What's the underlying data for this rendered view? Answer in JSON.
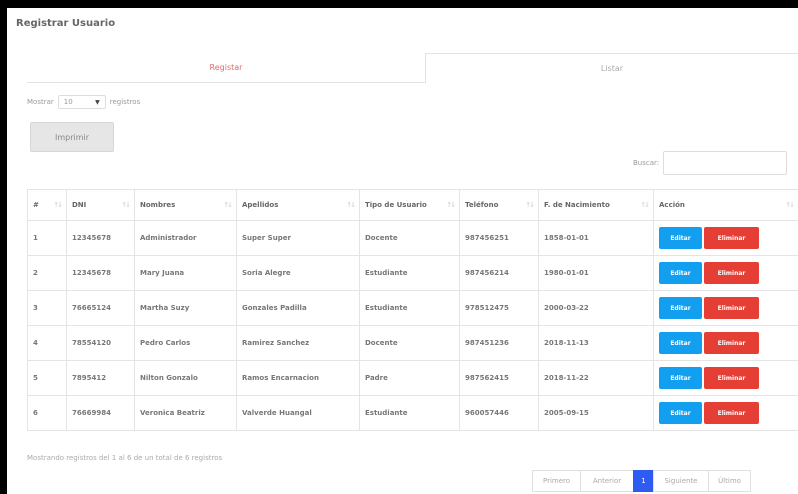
{
  "page_title": "Registrar Usuario",
  "tabs": {
    "register": "Registar",
    "list": "Listar"
  },
  "show": {
    "before": "Mostrar",
    "value": "10",
    "after": "registros"
  },
  "print_button": "Imprimir",
  "search": {
    "label": "Buscar:",
    "value": ""
  },
  "table": {
    "headers": [
      "#",
      "DNI",
      "Nombres",
      "Apellidos",
      "Tipo de Usuario",
      "Teléfono",
      "F. de Nacimiento",
      "Acción"
    ],
    "rows": [
      {
        "num": "1",
        "dni": "12345678",
        "nombres": "Administrador",
        "apellidos": "Super Super",
        "tipo": "Docente",
        "telefono": "987456251",
        "nacimiento": "1858-01-01"
      },
      {
        "num": "2",
        "dni": "12345678",
        "nombres": "Mary Juana",
        "apellidos": "Soria Alegre",
        "tipo": "Estudiante",
        "telefono": "987456214",
        "nacimiento": "1980-01-01"
      },
      {
        "num": "3",
        "dni": "76665124",
        "nombres": "Martha Suzy",
        "apellidos": "Gonzales Padilla",
        "tipo": "Estudiante",
        "telefono": "978512475",
        "nacimiento": "2000-03-22"
      },
      {
        "num": "4",
        "dni": "78554120",
        "nombres": "Pedro Carlos",
        "apellidos": "Ramirez Sanchez",
        "tipo": "Docente",
        "telefono": "987451236",
        "nacimiento": "2018-11-13"
      },
      {
        "num": "5",
        "dni": "7895412",
        "nombres": "Nilton Gonzalo",
        "apellidos": "Ramos Encarnacion",
        "tipo": "Padre",
        "telefono": "987562415",
        "nacimiento": "2018-11-22"
      },
      {
        "num": "6",
        "dni": "76669984",
        "nombres": "Veronica Beatriz",
        "apellidos": "Valverde Huangal",
        "tipo": "Estudiante",
        "telefono": "960057446",
        "nacimiento": "2005-09-15"
      }
    ],
    "edit_label": "Editar",
    "delete_label": "Eliminar"
  },
  "footer_info": "Mostrando registros del 1 al 6 de un total de 6 registros",
  "pagination": {
    "first": "Primero",
    "prev": "Anterior",
    "current": "1",
    "next": "Siguiente",
    "last": "Último"
  },
  "colors": {
    "edit": "#139ff0",
    "delete": "#e53e35",
    "active_page": "#2e5cf2",
    "active_tab": "#e06b6b"
  }
}
